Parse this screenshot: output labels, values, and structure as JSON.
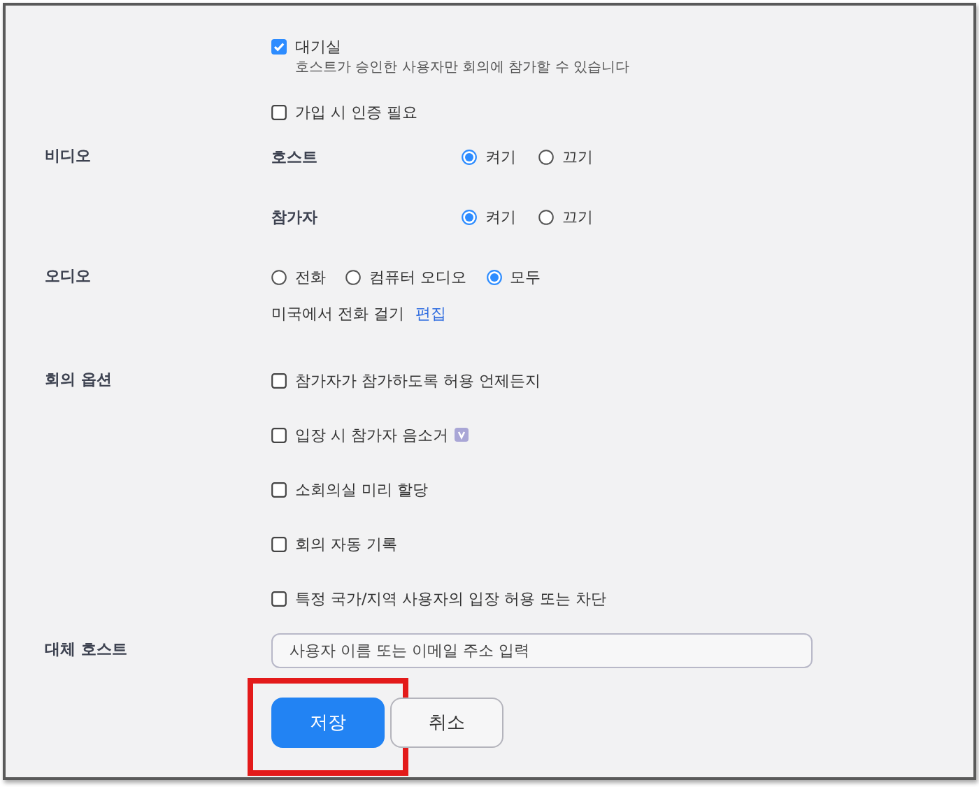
{
  "waiting_room": {
    "label": "대기실",
    "checked": true,
    "description": "호스트가 승인한 사용자만 회의에 참가할 수 있습니다"
  },
  "authentication": {
    "label": "가입 시 인증 필요",
    "checked": false
  },
  "video": {
    "label": "비디오",
    "rows": [
      {
        "label": "호스트",
        "options": [
          {
            "label": "켜기",
            "selected": true
          },
          {
            "label": "끄기",
            "selected": false
          }
        ]
      },
      {
        "label": "참가자",
        "options": [
          {
            "label": "켜기",
            "selected": true
          },
          {
            "label": "끄기",
            "selected": false
          }
        ]
      }
    ]
  },
  "audio": {
    "label": "오디오",
    "options": [
      {
        "label": "전화",
        "selected": false
      },
      {
        "label": "컴퓨터 오디오",
        "selected": false
      },
      {
        "label": "모두",
        "selected": true
      }
    ],
    "dial_in": "미국에서 전화 걸기",
    "edit_link": "편집"
  },
  "meeting_options": {
    "label": "회의 옵션",
    "items": [
      {
        "label": "참가자가 참가하도록 허용 언제든지",
        "checked": false,
        "badge": false
      },
      {
        "label": "입장 시 참가자 음소거",
        "checked": false,
        "badge": true
      },
      {
        "label": "소회의실 미리 할당",
        "checked": false,
        "badge": false
      },
      {
        "label": "회의 자동 기록",
        "checked": false,
        "badge": false
      },
      {
        "label": "특정 국가/지역 사용자의 입장 허용 또는 차단",
        "checked": false,
        "badge": false
      }
    ]
  },
  "alternative_host": {
    "label": "대체 호스트",
    "placeholder": "사용자 이름 또는 이메일 주소 입력"
  },
  "buttons": [
    {
      "label": "저장",
      "kind": "primary",
      "highlighted": true
    },
    {
      "label": "취소",
      "kind": "secondary",
      "highlighted": false
    }
  ]
}
